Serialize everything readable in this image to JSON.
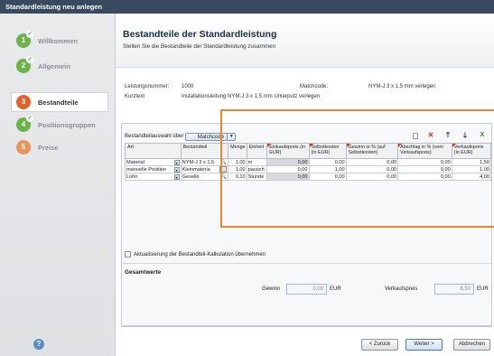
{
  "window": {
    "title": "Standardleistung neu anlegen"
  },
  "wizard": {
    "steps": [
      {
        "num": "1",
        "label": "Willkommen",
        "state": "done"
      },
      {
        "num": "2",
        "label": "Allgemein",
        "state": "done"
      },
      {
        "num": "3",
        "label": "Bestandteile",
        "state": "active"
      },
      {
        "num": "4",
        "label": "Positionsgruppen",
        "state": "done"
      },
      {
        "num": "5",
        "label": "Preise",
        "state": "todo"
      }
    ],
    "check_glyph": "✓"
  },
  "header": {
    "title": "Bestandteile der Standardleistung",
    "subtitle": "Stellen Sie die Bestandteile der Standardleistung zusammen"
  },
  "info": {
    "leistungsnummer_label": "Leistungsnummer:",
    "leistungsnummer_value": "1000",
    "matchcode_label": "Matchcode:",
    "matchcode_value": "NYM-J 3 x 1,5 mm verlegen",
    "kurztext_label": "Kurztext",
    "kurztext_value": "Installationsleitung NYM-J 3 x 1,5 mm Unterputz verlegen"
  },
  "selection": {
    "label": "Bestandteilauswahl über",
    "dropdown_value": "Matchcode",
    "dropdown_arrow": "▼"
  },
  "toolbar": {
    "delete_glyph": "✕",
    "up_glyph": "🡑",
    "down_glyph": "🡓",
    "excel_glyph": "X"
  },
  "table": {
    "headers": [
      "Art",
      "Bestandteil",
      "Menge",
      "Einheit",
      "Einkaufspreis (in EUR)",
      "Selbstkosten (in EUR)",
      "Gewinn in % (auf Selbstkosten)",
      "Abschlag in % (vom Verkaufspreis)",
      "Verkaufspreis (in EUR)"
    ],
    "rows": [
      {
        "art": "Material",
        "bestandteil": "NYM-J 3 x 1,5",
        "menge": "1,00",
        "einheit": "m",
        "einkauf": "0,00",
        "selbst": "0,00",
        "gewinn": "0,00",
        "abschlag": "0,00",
        "verkauf": "1,50",
        "action": "🔍"
      },
      {
        "art": "manuelle Position",
        "bestandteil": "Kleinmateria",
        "menge": "1,00",
        "einheit": "pausch",
        "einkauf": "0,00",
        "selbst": "1,00",
        "gewinn": "0,00",
        "abschlag": "0,00",
        "verkauf": "1,00",
        "action": "..."
      },
      {
        "art": "Lohn",
        "bestandteil": "Geselle",
        "menge": "0,10",
        "einheit": "Stunde",
        "einkauf": "0,00",
        "selbst": "0,00",
        "gewinn": "0,00",
        "abschlag": "0,00",
        "verkauf": "4,00",
        "action": "🔍"
      }
    ]
  },
  "checkbox": {
    "label": "Aktualisierung der Bestandteil-Kalkulation übernehmen",
    "checked": false
  },
  "totals": {
    "section_title": "Gesamtwerte",
    "gewinn_label": "Gewinn",
    "gewinn_value": "0,00",
    "gewinn_unit": "EUR",
    "verkauf_label": "Verkaufspreis",
    "verkauf_value": "6,50",
    "verkauf_unit": "EUR"
  },
  "footer": {
    "help": "?",
    "back": "< Zurück",
    "next": "Weiter >",
    "cancel": "Abbrechen"
  }
}
